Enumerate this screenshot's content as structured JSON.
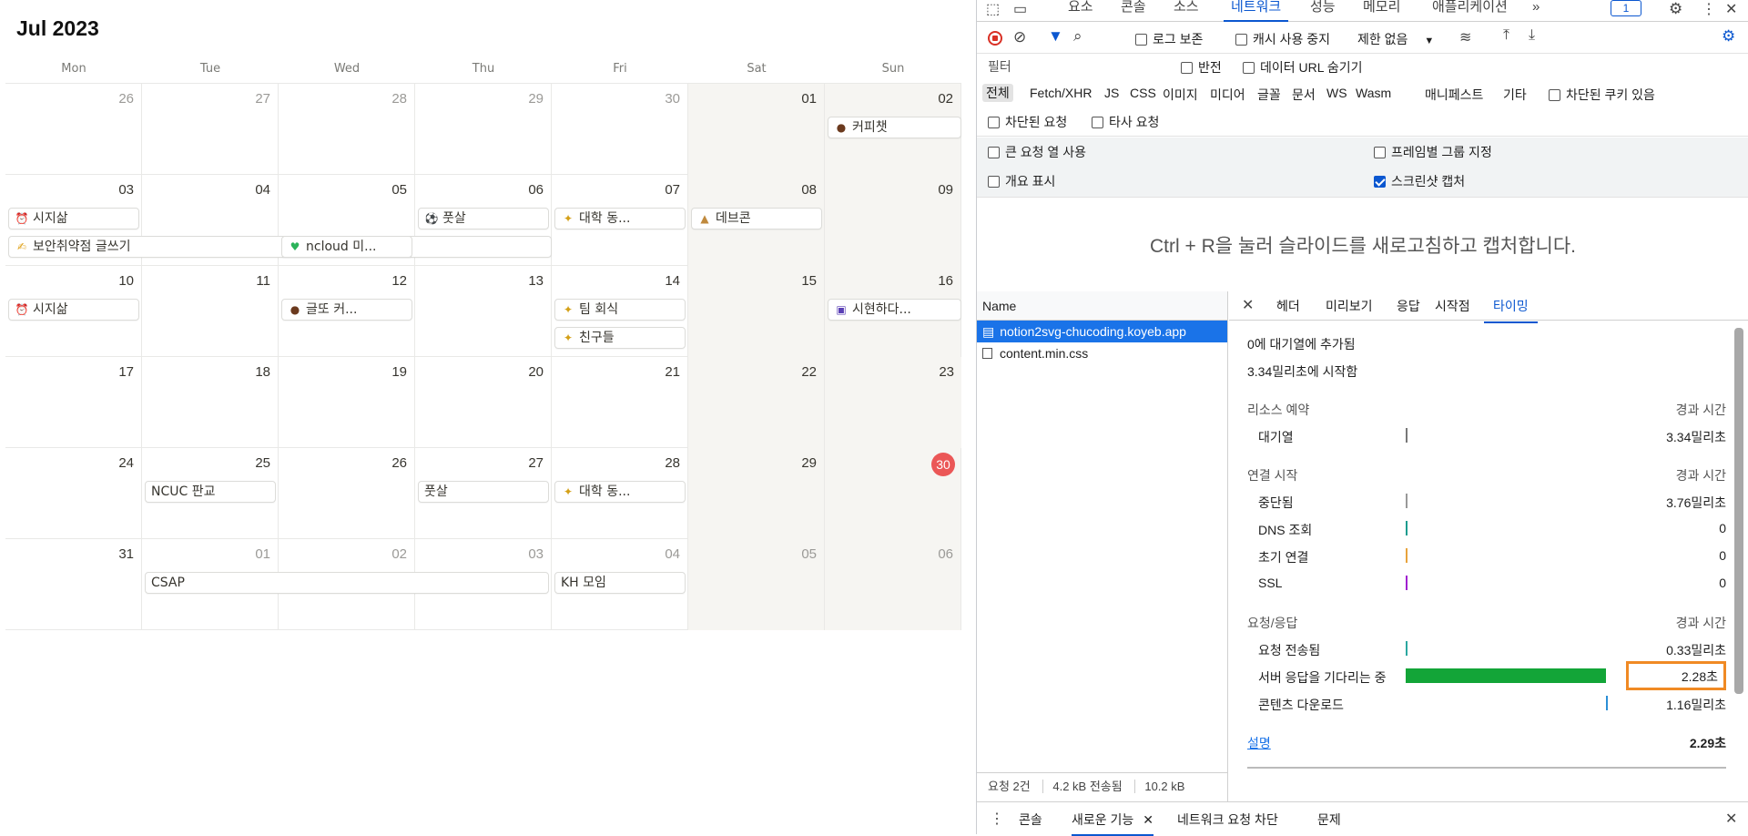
{
  "calendar": {
    "title": "Jul 2023",
    "weekdays": [
      "Mon",
      "Tue",
      "Wed",
      "Thu",
      "Fri",
      "Sat",
      "Sun"
    ],
    "weeks": [
      [
        "26",
        "27",
        "28",
        "29",
        "30",
        "01",
        "02"
      ],
      [
        "03",
        "04",
        "05",
        "06",
        "07",
        "08",
        "09"
      ],
      [
        "10",
        "11",
        "12",
        "13",
        "14",
        "15",
        "16"
      ],
      [
        "17",
        "18",
        "19",
        "20",
        "21",
        "22",
        "23"
      ],
      [
        "24",
        "25",
        "26",
        "27",
        "28",
        "29",
        "30"
      ],
      [
        "31",
        "01",
        "02",
        "03",
        "04",
        "05",
        "06"
      ]
    ],
    "events": {
      "coffee_chat": {
        "icon": "●",
        "label": "커피챗"
      },
      "sijisam1": {
        "icon": "⏰",
        "label": "시지삶"
      },
      "security": {
        "icon": "✍",
        "label": "보안취약점 글쓰기"
      },
      "ncloud": {
        "icon": "♥",
        "label": "ncloud 미..."
      },
      "futsal1": {
        "icon": "⚽",
        "label": "풋살"
      },
      "college1": {
        "icon": "✦",
        "label": "대학 동..."
      },
      "devcon": {
        "icon": "▲",
        "label": "데브콘"
      },
      "sijisam2": {
        "icon": "⏰",
        "label": "시지삶"
      },
      "geulttokeo": {
        "icon": "●",
        "label": "글또 커..."
      },
      "team_meeting": {
        "icon": "✦",
        "label": "팀 회식"
      },
      "friends": {
        "icon": "✦",
        "label": "친구들"
      },
      "sihyun": {
        "icon": "▣",
        "label": "시현하다..."
      },
      "ncuc": {
        "icon": "",
        "label": "NCUC 판교"
      },
      "futsal2": {
        "icon": "",
        "label": "풋살"
      },
      "college2": {
        "icon": "✦",
        "label": "대학 동..."
      },
      "csap": {
        "icon": "",
        "label": "CSAP"
      },
      "kh": {
        "icon": "",
        "label": "KH 모임"
      }
    }
  },
  "devtools": {
    "tabs": [
      "요소",
      "콘솔",
      "소스",
      "네트워크",
      "성능",
      "메모리",
      "애플리케이션"
    ],
    "more_tabs": "»",
    "issues_count": "1",
    "toolbar": {
      "preserve_log": "로그 보존",
      "disable_cache": "캐시 사용 중지",
      "throttling": "제한 없음"
    },
    "filter": {
      "placeholder": "필터",
      "invert": "반전",
      "hide_data_urls": "데이터 URL 숨기기"
    },
    "type_filters": [
      "전체",
      "Fetch/XHR",
      "JS",
      "CSS",
      "이미지",
      "미디어",
      "글꼴",
      "문서",
      "WS",
      "Wasm",
      "매니페스트",
      "기타"
    ],
    "blocked_cookies": "차단된 쿠키 있음",
    "blocked_requests": "차단된 요청",
    "third_party": "타사 요청",
    "options": {
      "big_rows": "큰 요청 열 사용",
      "group_by_frame": "프레임별 그룹 지정",
      "overview": "개요 표시",
      "screenshots": "스크린샷 캡처"
    },
    "reload_hint": "Ctrl + R을 눌러 슬라이드를 새로고침하고 캡처합니다.",
    "name_header": "Name",
    "requests": [
      "notion2svg-chucoding.koyeb.app",
      "content.min.css"
    ],
    "status_bar": {
      "requests": "요청 2건",
      "transferred": "4.2 kB 전송됨",
      "resources": "10.2 kB"
    },
    "detail_tabs": [
      "헤더",
      "미리보기",
      "응답",
      "시작점",
      "타이밍"
    ],
    "timing": {
      "queued_at": "0에 대기열에 추가됨",
      "started_at": "3.34밀리초에 시작함",
      "elapsed_label": "경과 시간",
      "resource_scheduling": "리소스 예약",
      "queueing": {
        "label": "대기열",
        "value": "3.34밀리초"
      },
      "connection_start": "연결 시작",
      "stalled": {
        "label": "중단됨",
        "value": "3.76밀리초"
      },
      "dns": {
        "label": "DNS 조회",
        "value": "0"
      },
      "initial_connection": {
        "label": "초기 연결",
        "value": "0"
      },
      "ssl": {
        "label": "SSL",
        "value": "0"
      },
      "request_response": "요청/응답",
      "request_sent": {
        "label": "요청 전송됨",
        "value": "0.33밀리초"
      },
      "waiting": {
        "label": "서버 응답을 기다리는 중",
        "value": "2.28초"
      },
      "content_download": {
        "label": "콘텐츠 다운로드",
        "value": "1.16밀리초"
      },
      "explanation": "설명",
      "total": "2.29초"
    },
    "drawer_tabs": [
      "콘솔",
      "새로운 기능",
      "네트워크 요청 차단",
      "문제"
    ],
    "colors": {
      "accent": "#0b57d0",
      "waiting_bar": "#13a538",
      "highlight": "#f08a24",
      "today": "#eb5757"
    }
  }
}
